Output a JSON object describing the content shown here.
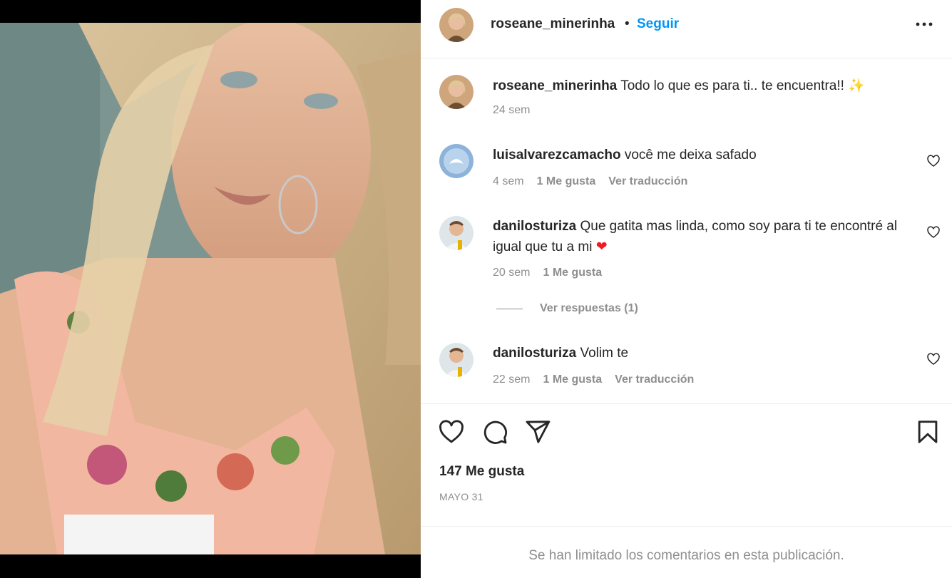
{
  "post": {
    "author": "roseane_minerinha",
    "separator": "•",
    "follow_label": "Seguir",
    "more_icon": "more-options-icon"
  },
  "caption": {
    "user": "roseane_minerinha",
    "text": "Todo lo que es para ti.. te encuentra!! ✨",
    "time": "24 sem"
  },
  "comments": [
    {
      "user": "luisalvarezcamacho",
      "text": "você me deixa safado",
      "time": "4 sem",
      "likes": "1 Me gusta",
      "translate": "Ver traducción"
    },
    {
      "user": "danilosturiza",
      "text": "Que gatita mas linda, como soy para ti te encontré al igual que tu a mi",
      "emoji": "❤",
      "time": "20 sem",
      "likes": "1 Me gusta",
      "replies": "Ver respuestas (1)"
    },
    {
      "user": "danilosturiza",
      "text": "Volim te",
      "time": "22 sem",
      "likes": "1 Me gusta",
      "translate": "Ver traducción"
    }
  ],
  "actions": {
    "like_icon": "heart-icon",
    "comment_icon": "comment-icon",
    "share_icon": "send-icon",
    "save_icon": "bookmark-icon"
  },
  "likes_count": "147 Me gusta",
  "date": "MAYO 31",
  "footer_notice": "Se han limitado los comentarios en esta publicación.",
  "colors": {
    "accent": "#0095f6",
    "muted": "#8e8e8e",
    "text": "#262626",
    "heart_emoji": "#ed1c24"
  }
}
